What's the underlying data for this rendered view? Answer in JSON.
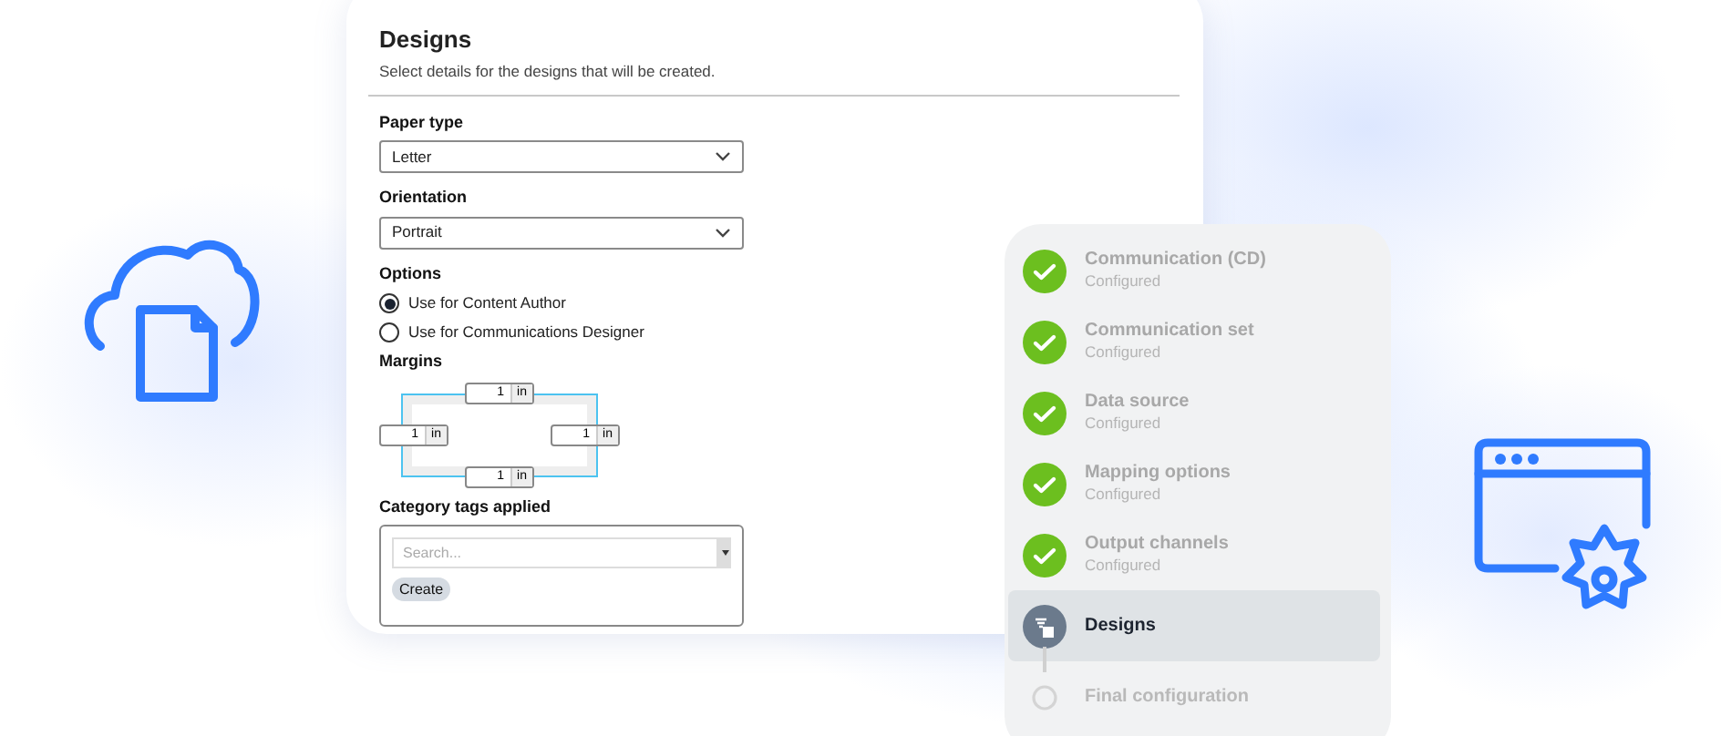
{
  "form": {
    "title": "Designs",
    "subtitle": "Select details for the designs that will be created.",
    "paper_type": {
      "label": "Paper type",
      "value": "Letter"
    },
    "orientation": {
      "label": "Orientation",
      "value": "Portrait"
    },
    "options": {
      "label": "Options",
      "items": [
        {
          "label": "Use for Content Author",
          "selected": true
        },
        {
          "label": "Use for Communications Designer",
          "selected": false
        }
      ]
    },
    "margins": {
      "label": "Margins",
      "top": {
        "value": "1",
        "unit": "in"
      },
      "left": {
        "value": "1",
        "unit": "in"
      },
      "right": {
        "value": "1",
        "unit": "in"
      },
      "bottom": {
        "value": "1",
        "unit": "in"
      }
    },
    "category_tags": {
      "label": "Category tags applied",
      "placeholder": "Search...",
      "button": "Create"
    }
  },
  "steps": [
    {
      "title": "Communication (CD)",
      "status": "Configured",
      "kind": "done",
      "selected": false
    },
    {
      "title": "Communication set",
      "status": "Configured",
      "kind": "done",
      "selected": false
    },
    {
      "title": "Data source",
      "status": "Configured",
      "kind": "done",
      "selected": false
    },
    {
      "title": "Mapping options",
      "status": "Configured",
      "kind": "done",
      "selected": false
    },
    {
      "title": "Output channels",
      "status": "Configured",
      "kind": "done",
      "selected": false
    },
    {
      "title": "Designs",
      "kind": "current",
      "selected": true
    },
    {
      "title": "Final configuration",
      "kind": "pending",
      "selected": false
    }
  ]
}
